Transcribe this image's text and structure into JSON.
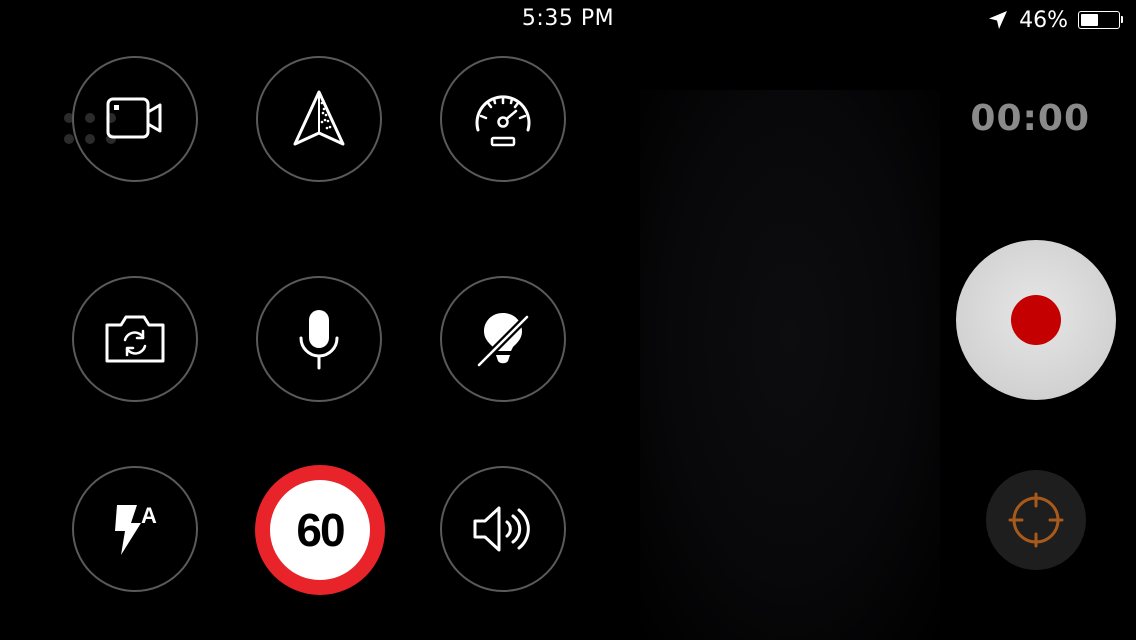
{
  "status_bar": {
    "time": "5:35 PM",
    "battery_text": "46%",
    "battery_level": 0.46,
    "location_icon": "location-arrow-icon"
  },
  "timer": {
    "value": "00:00"
  },
  "speed_limit": {
    "value": "60",
    "ring_color": "#e8242a"
  },
  "record": {
    "dot_color": "#c40000"
  },
  "focus": {
    "icon": "crosshair-icon",
    "color": "#a85a1c"
  },
  "controls": [
    {
      "name": "video-mode-button",
      "icon": "video-camera-icon"
    },
    {
      "name": "navigation-button",
      "icon": "navigation-arrow-icon"
    },
    {
      "name": "speedometer-button",
      "icon": "speedometer-icon"
    },
    {
      "name": "switch-camera-button",
      "icon": "camera-switch-icon"
    },
    {
      "name": "microphone-button",
      "icon": "microphone-icon"
    },
    {
      "name": "light-off-button",
      "icon": "lightbulb-off-icon"
    },
    {
      "name": "flash-auto-button",
      "icon": "flash-auto-icon",
      "label": "A"
    },
    {
      "name": "speed-limit-button",
      "icon": "speed-limit-sign-icon"
    },
    {
      "name": "speaker-button",
      "icon": "speaker-volume-icon"
    }
  ]
}
